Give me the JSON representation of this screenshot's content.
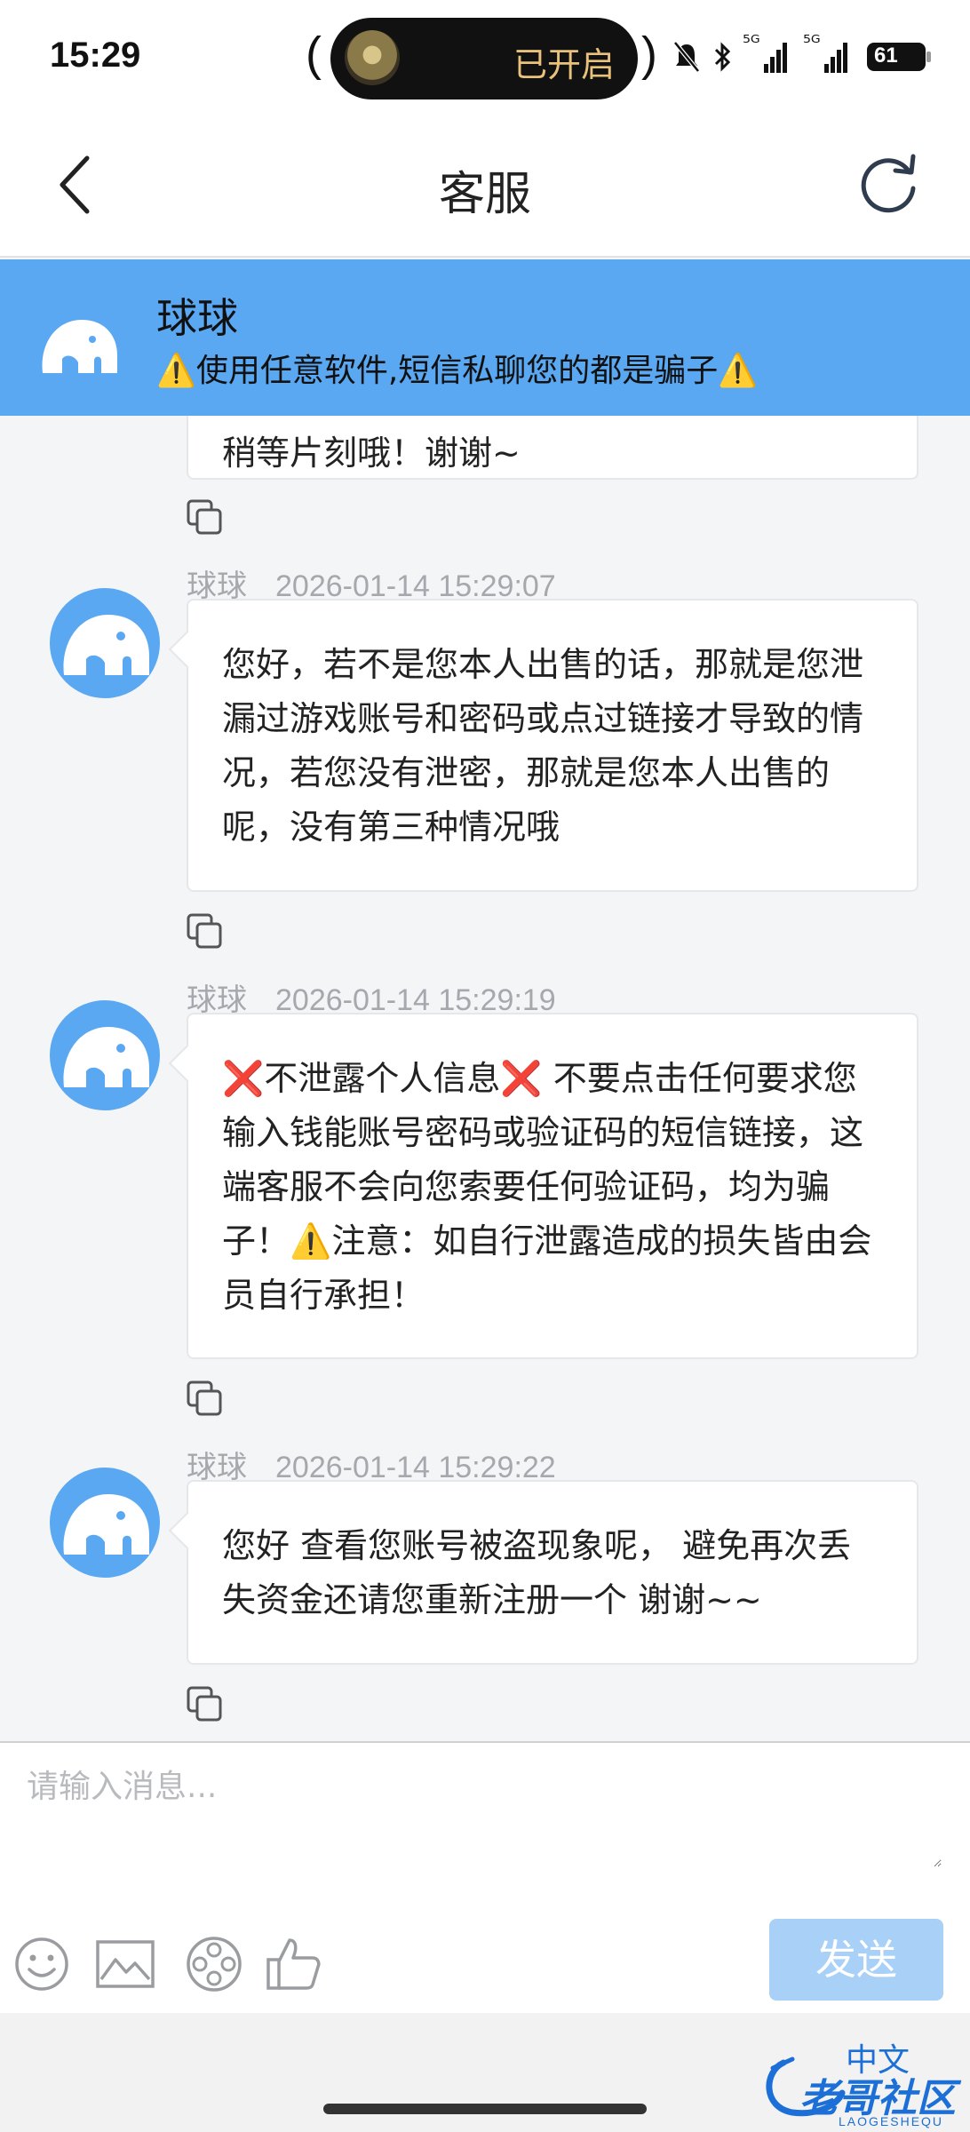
{
  "status_bar": {
    "time": "15:29",
    "pill_text": "已开启",
    "signal_1": "⁵ᴳ",
    "signal_2": "⁵ᴳ",
    "battery": "61"
  },
  "header": {
    "title": "客服"
  },
  "notice": {
    "name": "球球",
    "text": "⚠️使用任意软件,短信私聊您的都是骗子⚠️"
  },
  "chat": {
    "partial_text": "稍等片刻哦！谢谢~",
    "messages": [
      {
        "sender": "球球",
        "time": "2026-01-14 15:29:07",
        "text": "您好，若不是您本人出售的话，那就是您泄漏过游戏账号和密码或点过链接才导致的情况，若您没有泄密，那就是您本人出售的呢，没有第三种情况哦"
      },
      {
        "sender": "球球",
        "time": "2026-01-14 15:29:19",
        "text": "❌不泄露个人信息❌ 不要点击任何要求您输入钱能账号密码或验证码的短信链接，这端客服不会向您索要任何验证码，均为骗子！⚠️注意：如自行泄露造成的损失皆由会员自行承担！"
      },
      {
        "sender": "球球",
        "time": "2026-01-14 15:29:22",
        "text": "您好 查看您账号被盗现象呢， 避免再次丢失资金还请您重新注册一个 谢谢~~"
      }
    ]
  },
  "input": {
    "placeholder": "请输入消息...",
    "send_label": "发送"
  },
  "watermark": {
    "top": "中文",
    "main": "老哥社区",
    "sub": "LAOGESHEQU"
  },
  "colors": {
    "accent": "#5aa7f2",
    "send_button": "#a9d1f7",
    "background": "#f4f5f7"
  }
}
